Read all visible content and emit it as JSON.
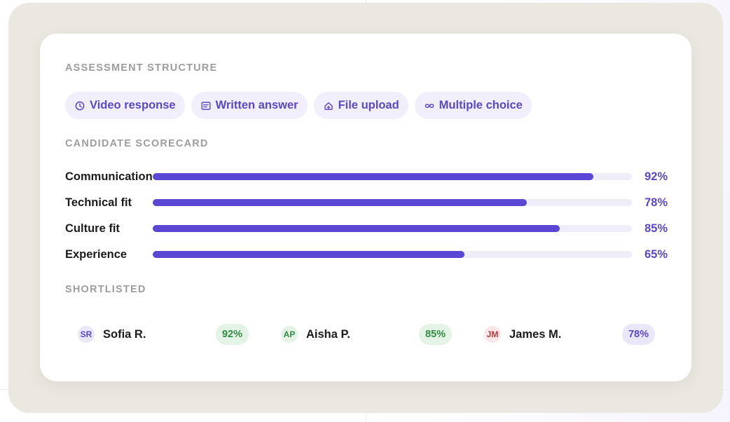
{
  "colors": {
    "accent": "#5a48d4",
    "accent_text": "#5a48c6",
    "chip_bg": "#f1effb",
    "track_bg": "#efedf8",
    "section_label": "#9d9d9d",
    "frame_bg": "#ebe8e1",
    "green_bg": "#e4f3e6",
    "green_text": "#2f8a44",
    "purple_bg": "#ebe7fb",
    "red_bg": "#fbe7e7",
    "red_text": "#b53a3a"
  },
  "assessment": {
    "label": "ASSESSMENT STRUCTURE",
    "chips": [
      {
        "label": "Video response",
        "icon": "clock-icon"
      },
      {
        "label": "Written answer",
        "icon": "document-icon"
      },
      {
        "label": "File upload",
        "icon": "upload-icon"
      },
      {
        "label": "Multiple choice",
        "icon": "infinity-icon"
      }
    ]
  },
  "scorecard": {
    "label": "CANDIDATE SCORECARD",
    "rows": [
      {
        "label": "Communication",
        "value_text": "92%",
        "value": 92
      },
      {
        "label": "Technical fit",
        "value_text": "78%",
        "value": 78
      },
      {
        "label": "Culture fit",
        "value_text": "85%",
        "value": 85
      },
      {
        "label": "Experience",
        "value_text": "65%",
        "value": 65
      }
    ]
  },
  "shortlisted": {
    "label": "SHORTLISTED",
    "candidates": [
      {
        "initials": "SR",
        "name": "Sofia R.",
        "score": "92%",
        "avatar_style": "purple",
        "score_style": "green"
      },
      {
        "initials": "AP",
        "name": "Aisha P.",
        "score": "85%",
        "avatar_style": "green",
        "score_style": "green"
      },
      {
        "initials": "JM",
        "name": "James M.",
        "score": "78%",
        "avatar_style": "red",
        "score_style": "purple"
      }
    ]
  }
}
